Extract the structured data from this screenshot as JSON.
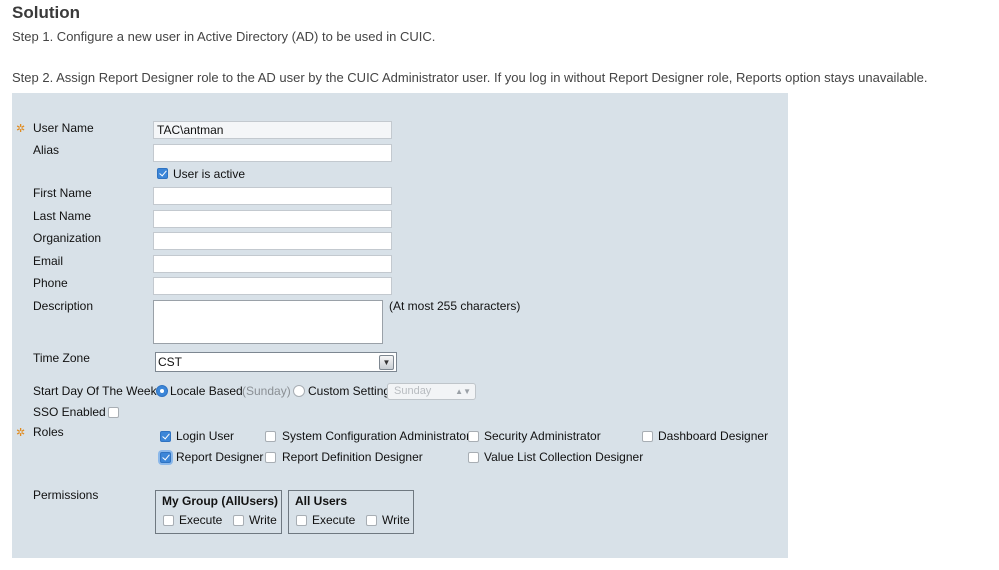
{
  "heading": "Solution",
  "step1": "Step 1. Configure a new user in Active Directory (AD) to be used in CUIC.",
  "step2": "Step 2. Assign Report Designer role to the AD user by the CUIC Administrator user. If you log in without Report Designer role, Reports option stays unavailable.",
  "form": {
    "required_marker": "✲",
    "user_name_label": "User Name",
    "user_name_value": "TAC\\antman",
    "alias_label": "Alias",
    "alias_value": "",
    "user_active_label": "User is active",
    "first_name_label": "First Name",
    "last_name_label": "Last Name",
    "organization_label": "Organization",
    "email_label": "Email",
    "phone_label": "Phone",
    "description_label": "Description",
    "description_note": "(At most 255 characters)",
    "time_zone_label": "Time Zone",
    "time_zone_value": "CST",
    "start_day_label": "Start Day Of The Week",
    "locale_based_label": "Locale Based",
    "locale_based_hint": "(Sunday)",
    "custom_setting_label": "Custom Setting",
    "custom_day_value": "Sunday",
    "sso_label": "SSO Enabled",
    "roles_label": "Roles",
    "roles": {
      "login_user": "Login User",
      "system_config_admin": "System Configuration Administrator",
      "security_admin": "Security Administrator",
      "dashboard_designer": "Dashboard Designer",
      "report_designer": "Report Designer",
      "report_definition_designer": "Report Definition Designer",
      "value_list_designer": "Value List Collection Designer"
    },
    "permissions_label": "Permissions",
    "perm_group1_title": "My Group (AllUsers)",
    "perm_group2_title": "All Users",
    "execute_label": "Execute",
    "write_label": "Write"
  },
  "colors": {
    "required": "#e08a1e",
    "panel_bg": "#d8e1e8",
    "checkbox_checked": "#3c86d8"
  }
}
